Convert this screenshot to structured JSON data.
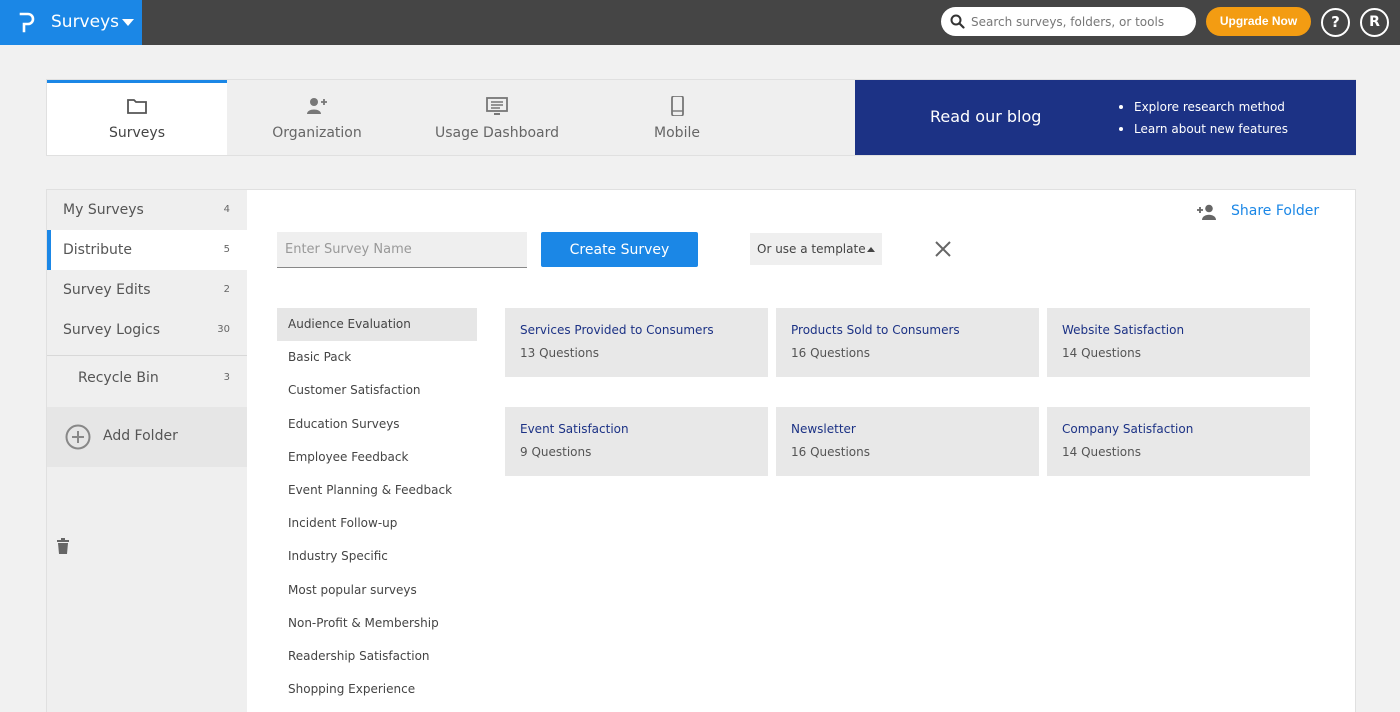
{
  "app": {
    "name": "Surveys"
  },
  "search": {
    "placeholder": "Search surveys, folders, or tools"
  },
  "header": {
    "upgrade_label": "Upgrade Now",
    "help_label": "?",
    "user_initial": "R"
  },
  "nav": {
    "tabs": [
      {
        "label": "Surveys",
        "icon": "folder-icon",
        "active": true
      },
      {
        "label": "Organization",
        "icon": "add-user-icon"
      },
      {
        "label": "Usage Dashboard",
        "icon": "monitor-icon"
      },
      {
        "label": "Mobile",
        "icon": "mobile-icon"
      }
    ]
  },
  "blog": {
    "title": "Read our blog",
    "bullets": [
      "Explore research method",
      "Learn about new features"
    ]
  },
  "sidebar": {
    "folders": [
      {
        "label": "My Surveys",
        "count": "4"
      },
      {
        "label": "Distribute",
        "count": "5",
        "active": true
      },
      {
        "label": "Survey Edits",
        "count": "2"
      },
      {
        "label": "Survey Logics",
        "count": "30"
      }
    ],
    "recycle": {
      "label": "Recycle Bin",
      "count": "3"
    },
    "add_folder_label": "Add Folder"
  },
  "main": {
    "share_label": "Share Folder",
    "survey_name_placeholder": "Enter Survey Name",
    "create_label": "Create Survey",
    "template_label": "Or use a template"
  },
  "categories": [
    "Audience Evaluation",
    "Basic Pack",
    "Customer Satisfaction",
    "Education Surveys",
    "Employee Feedback",
    "Event Planning & Feedback",
    "Incident Follow-up",
    "Industry Specific",
    "Most popular surveys",
    "Non-Profit & Membership",
    "Readership Satisfaction",
    "Shopping Experience"
  ],
  "templates": [
    {
      "title": "Services Provided to Consumers",
      "questions": "13 Questions"
    },
    {
      "title": "Products Sold to Consumers",
      "questions": "16 Questions"
    },
    {
      "title": "Website Satisfaction",
      "questions": "14 Questions"
    },
    {
      "title": "Event Satisfaction",
      "questions": "9 Questions"
    },
    {
      "title": "Newsletter",
      "questions": "16 Questions"
    },
    {
      "title": "Company Satisfaction",
      "questions": "14 Questions"
    }
  ],
  "colors": {
    "brand": "#1b87e6",
    "topbar": "#454545",
    "upgrade": "#f39c12",
    "blog": "#1c3285"
  }
}
